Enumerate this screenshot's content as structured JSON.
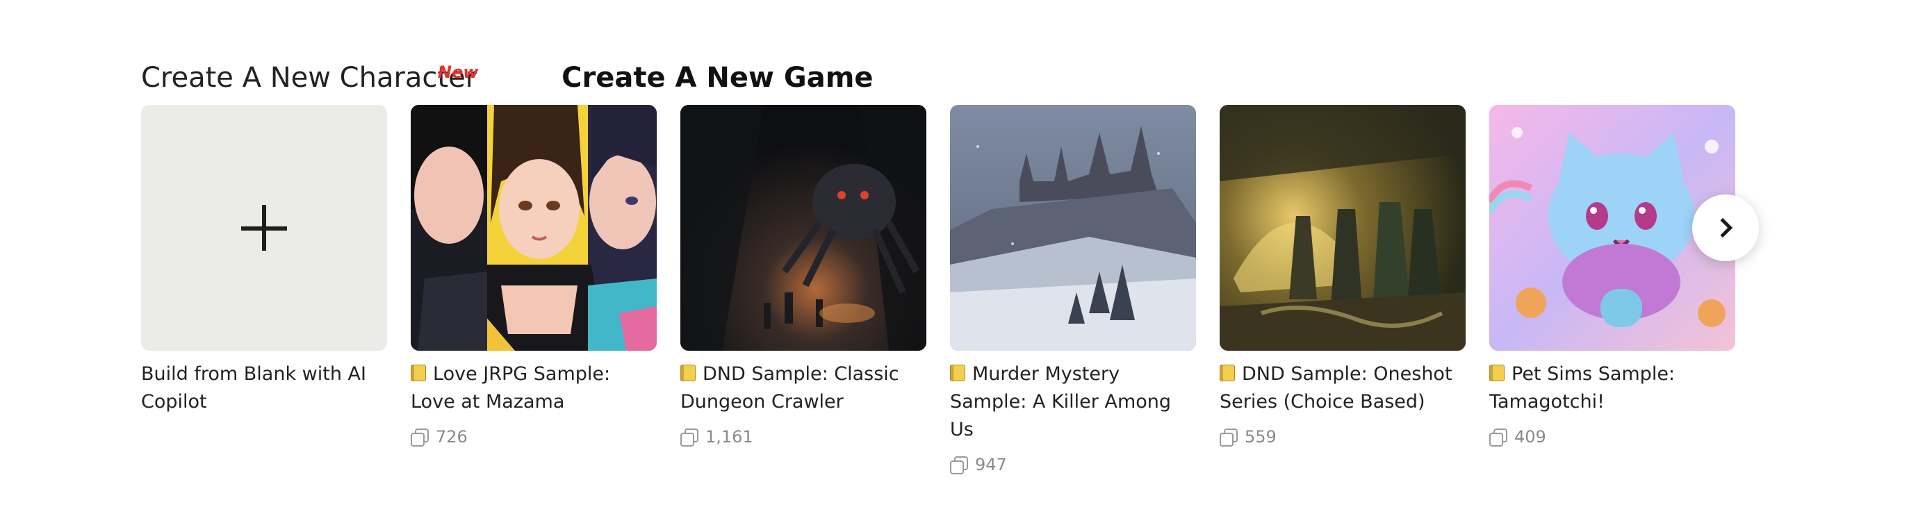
{
  "tabs": {
    "character": "Create A New Character",
    "new_badge": "New",
    "game": "Create A New Game"
  },
  "cards": [
    {
      "title": "Build from Blank with AI Copilot"
    },
    {
      "title": "Love JRPG Sample: Love at Mazama",
      "count": "726",
      "icon": "folder-icon"
    },
    {
      "title": "DND Sample: Classic Dungeon Crawler",
      "count": "1,161",
      "icon": "folder-icon"
    },
    {
      "title": "Murder Mystery Sample: A Killer Among Us",
      "count": "947",
      "icon": "folder-icon"
    },
    {
      "title": "DND Sample: Oneshot Series (Choice Based)",
      "count": "559",
      "icon": "folder-icon"
    },
    {
      "title": "Pet Sims Sample: Tamagotchi!",
      "count": "409",
      "icon": "folder-icon"
    }
  ],
  "colors": {
    "accent_new": "#e4322b",
    "blank_bg": "#ebebe8",
    "meta_text": "#8a8a8a"
  }
}
